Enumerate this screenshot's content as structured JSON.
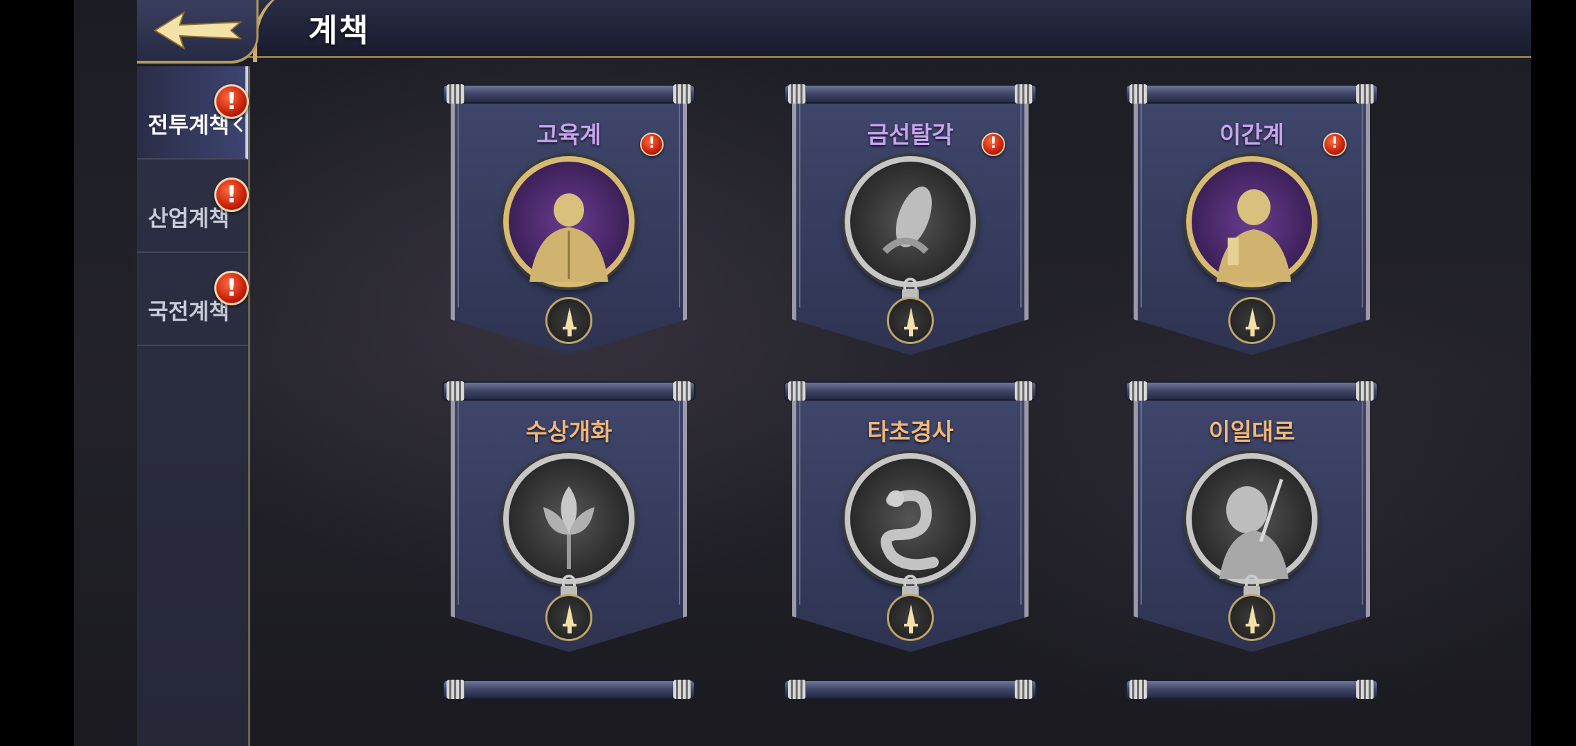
{
  "header": {
    "title": "계책"
  },
  "sidebar": {
    "items": [
      {
        "label": "전투계책",
        "active": true,
        "alert": "!"
      },
      {
        "label": "산업계책",
        "active": false,
        "alert": "!"
      },
      {
        "label": "국전계책",
        "active": false,
        "alert": "!"
      }
    ]
  },
  "strategies": [
    {
      "name": "고육계",
      "unlocked": true,
      "alert": "!",
      "icon": "muscle-warrior-icon"
    },
    {
      "name": "금선탈각",
      "unlocked": false,
      "alert": "!",
      "icon": "cicada-icon"
    },
    {
      "name": "이간계",
      "unlocked": true,
      "alert": "!",
      "icon": "scholar-icon"
    },
    {
      "name": "수상개화",
      "unlocked": false,
      "alert": "",
      "icon": "lotus-icon"
    },
    {
      "name": "타초경사",
      "unlocked": false,
      "alert": "",
      "icon": "snake-icon"
    },
    {
      "name": "이일대로",
      "unlocked": false,
      "alert": "",
      "icon": "armored-warrior-icon"
    }
  ],
  "colors": {
    "unlocked_name": "#c9a4f0",
    "locked_name": "#f1b779",
    "alert_red": "#c8200a",
    "gold_trim": "#c9ab6a"
  }
}
